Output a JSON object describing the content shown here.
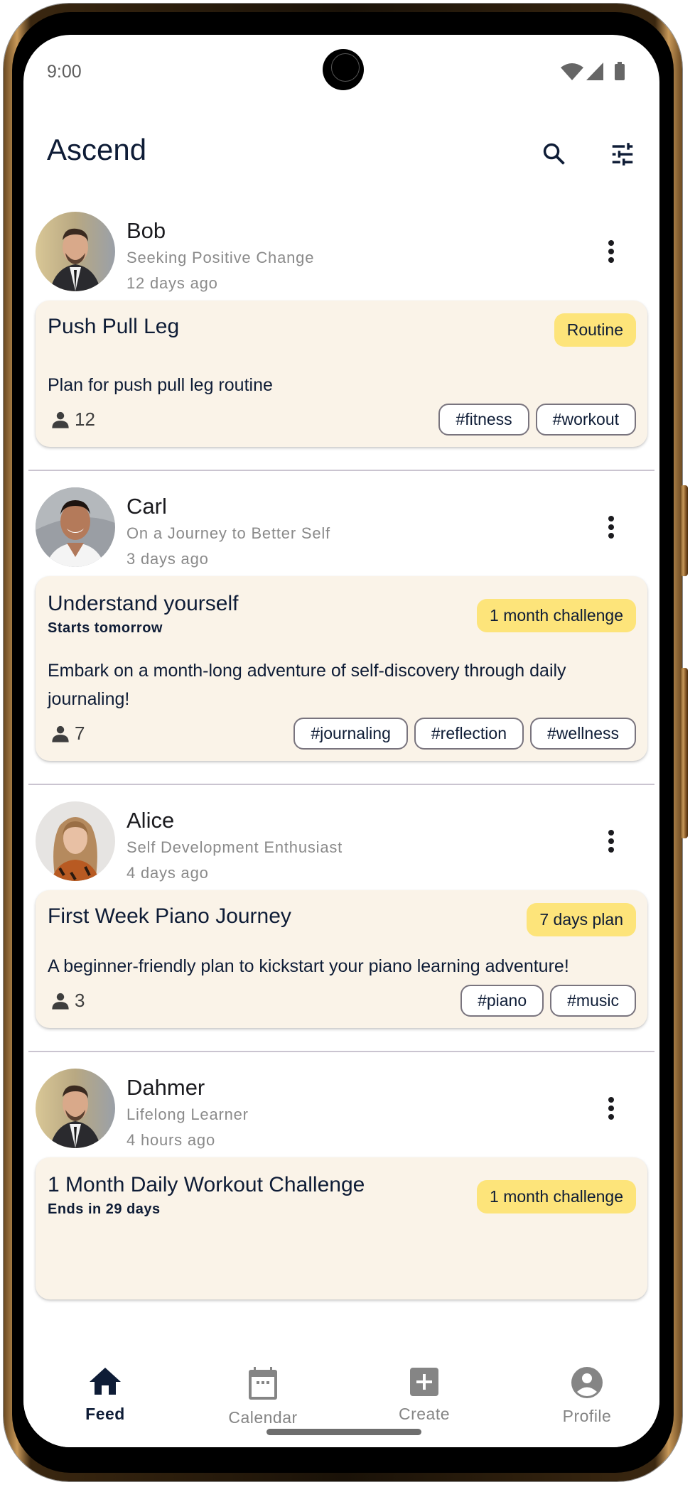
{
  "status_bar": {
    "time": "9:00",
    "icons": [
      "wifi-icon",
      "signal-icon",
      "battery-icon"
    ]
  },
  "app_bar": {
    "title": "Ascend",
    "actions": [
      "search-icon",
      "tune-icon"
    ]
  },
  "feed": {
    "posts": [
      {
        "user": {
          "name": "Bob",
          "tagline": "Seeking Positive Change",
          "time": "12 days ago"
        },
        "card": {
          "title": "Push Pull Leg",
          "subtitle": "",
          "badge": "Routine",
          "description": "Plan for push pull leg routine",
          "participants": "12",
          "tags": [
            "#fitness",
            "#workout"
          ]
        }
      },
      {
        "user": {
          "name": "Carl",
          "tagline": "On a Journey to Better Self",
          "time": "3 days ago"
        },
        "card": {
          "title": "Understand yourself",
          "subtitle": "Starts tomorrow",
          "badge": "1 month challenge",
          "description": "Embark on a month-long adventure of self-discovery through daily journaling!",
          "participants": "7",
          "tags": [
            "#journaling",
            "#reflection",
            "#wellness"
          ]
        }
      },
      {
        "user": {
          "name": "Alice",
          "tagline": "Self Development Enthusiast",
          "time": "4 days ago"
        },
        "card": {
          "title": "First Week Piano Journey",
          "subtitle": "",
          "badge": "7 days plan",
          "description": "A beginner-friendly plan to kickstart your piano learning adventure!",
          "participants": "3",
          "tags": [
            "#piano",
            "#music"
          ]
        }
      },
      {
        "user": {
          "name": "Dahmer",
          "tagline": "Lifelong Learner",
          "time": "4 hours ago"
        },
        "card": {
          "title": "1 Month Daily Workout Challenge",
          "subtitle": "Ends in 29 days",
          "badge": "1 month challenge",
          "description": "",
          "participants": "",
          "tags": []
        }
      }
    ]
  },
  "bottom_nav": {
    "items": [
      {
        "label": "Feed",
        "icon": "home-icon",
        "active": true
      },
      {
        "label": "Calendar",
        "icon": "calendar-icon",
        "active": false
      },
      {
        "label": "Create",
        "icon": "add-box-icon",
        "active": false
      },
      {
        "label": "Profile",
        "icon": "account-circle-icon",
        "active": false
      }
    ]
  },
  "colors": {
    "primary_text": "#0e1c36",
    "secondary_text": "#8a8a8a",
    "card_background": "#faf3e8",
    "badge_background": "#fde47a",
    "tag_border": "#79747e",
    "divider": "#cac4d0",
    "nav_inactive": "#858585"
  }
}
